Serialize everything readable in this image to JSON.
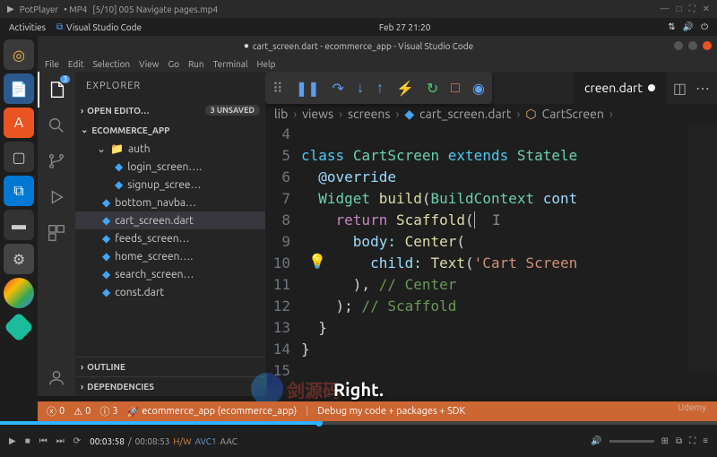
{
  "potplayer": {
    "title": "PotPlayer",
    "badge": "• MP4",
    "file": "[5/10] 005 Navigate pages.mp4"
  },
  "ubuntu": {
    "activities": "Activities",
    "app": "Visual Studio Code",
    "clock": "Feb 27  21:20"
  },
  "vscode_title": "cart_screen.dart - ecommerce_app - Visual Studio Code",
  "menu": [
    "File",
    "Edit",
    "Selection",
    "View",
    "Go",
    "Run",
    "Terminal",
    "Help"
  ],
  "activity_badge": "3",
  "explorer": {
    "title": "EXPLORER",
    "open_editors": "OPEN EDITO…",
    "unsaved": "3 UNSAVED",
    "project": "ECOMMERCE_APP",
    "folder_auth": "auth",
    "files": [
      "login_screen….",
      "signup_scree…",
      "bottom_navba…",
      "cart_screen.dart",
      "feeds_screen…",
      "home_screen….",
      "search_screen…",
      "const.dart"
    ],
    "outline": "OUTLINE",
    "deps": "DEPENDENCIES"
  },
  "tab": "creen.dart",
  "breadcrumb": {
    "p1": "lib",
    "p2": "views",
    "p3": "screens",
    "p4": "cart_screen.dart",
    "p5": "CartScreen"
  },
  "code": {
    "line_start": 4,
    "l5a": "class",
    "l5b": "CartScreen",
    "l5c": "extends",
    "l5d": "Statele",
    "l6": "@override",
    "l7a": "Widget",
    "l7b": "build",
    "l7c": "BuildContext",
    "l7d": "cont",
    "l8a": "return",
    "l8b": "Scaffold",
    "l9a": "body:",
    "l9b": "Center",
    "l10a": "child:",
    "l10b": "Text",
    "l10c": "'Cart Screen",
    "l11a": "),",
    "l11b": "// Center",
    "l12a": ");",
    "l12b": "// Scaffold",
    "l13": "}",
    "l14": "}"
  },
  "subtitle": "Right.",
  "status": {
    "errors": "0",
    "warnings": "0",
    "info": "3",
    "launch": "ecommerce_app (ecommerce_app)",
    "debug_mode": "Debug my code + packages + SDK"
  },
  "watermark_text": "剑源码",
  "udemy": "Udemy",
  "player": {
    "current": "00:03:58",
    "total": "00:08:53",
    "hw": "H/W",
    "codec": "AVC1",
    "audio": "AAC",
    "progress_pct": 44
  }
}
